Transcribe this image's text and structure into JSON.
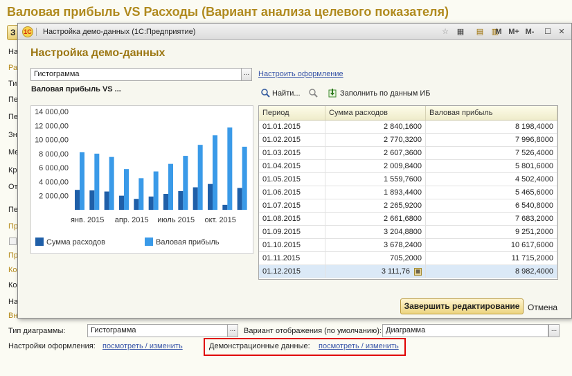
{
  "background": {
    "title": "Валовая прибыль VS Расходы (Вариант анализа целевого показателя)",
    "button_letter": "З",
    "side_labels": [
      "На",
      "Ра",
      "Тип",
      "Пе",
      "Пе",
      "Зна",
      "Ме",
      "Кр",
      "От",
      "Пе",
      "Пр",
      "",
      "Пр",
      "Ко",
      "Ко",
      "На",
      "Вн"
    ],
    "chart_type_label": "Тип диаграммы:",
    "chart_type_value": "Гистограмма",
    "display_variant_label": "Вариант отображения (по умолчанию):",
    "display_variant_value": "Диаграмма",
    "design_settings_label": "Настройки оформления:",
    "design_settings_link": "посмотреть / изменить",
    "demo_data_label": "Демонстрационные данные:",
    "demo_data_link": "посмотреть / изменить"
  },
  "modal": {
    "window_title": "Настройка демо-данных  (1С:Предприятие)",
    "app_icon_text": "1С",
    "heading": "Настройка демо-данных",
    "chart_type_value": "Гистограмма",
    "design_link": "Настроить оформление",
    "chart_title": "Валовая прибыль VS ...",
    "toolbar": {
      "find_label": "Найти...",
      "fill_label": "Заполнить по данным ИБ"
    },
    "titlebar_buttons": [
      "M",
      "M+",
      "M-"
    ],
    "columns": [
      "Период",
      "Сумма расходов",
      "Валовая прибыль"
    ],
    "rows": [
      [
        "01.01.2015",
        "2 840,1600",
        "8 198,4000"
      ],
      [
        "01.02.2015",
        "2 770,3200",
        "7 996,8000"
      ],
      [
        "01.03.2015",
        "2 607,3600",
        "7 526,4000"
      ],
      [
        "01.04.2015",
        "2 009,8400",
        "5 801,6000"
      ],
      [
        "01.05.2015",
        "1 559,7600",
        "4 502,4000"
      ],
      [
        "01.06.2015",
        "1 893,4400",
        "5 465,6000"
      ],
      [
        "01.07.2015",
        "2 265,9200",
        "6 540,8000"
      ],
      [
        "01.08.2015",
        "2 661,6800",
        "7 683,2000"
      ],
      [
        "01.09.2015",
        "3 204,8800",
        "9 251,2000"
      ],
      [
        "01.10.2015",
        "3 678,2400",
        "10 617,6000"
      ],
      [
        "01.11.2015",
        "705,2000",
        "11 715,2000"
      ],
      [
        "01.12.2015",
        "3 111,76",
        "8 982,4000"
      ]
    ],
    "finish_button": "Завершить редактирование",
    "cancel_button": "Отмена"
  },
  "chart_data": {
    "type": "bar",
    "categories": [
      "01.01.2015",
      "01.02.2015",
      "01.03.2015",
      "01.04.2015",
      "01.05.2015",
      "01.06.2015",
      "01.07.2015",
      "01.08.2015",
      "01.09.2015",
      "01.10.2015",
      "01.11.2015",
      "01.12.2015"
    ],
    "series": [
      {
        "name": "Сумма расходов",
        "color": "#1f5fa8",
        "values": [
          2840.16,
          2770.32,
          2607.36,
          2009.84,
          1559.76,
          1893.44,
          2265.92,
          2661.68,
          3204.88,
          3678.24,
          705.2,
          3111.76
        ]
      },
      {
        "name": "Валовая прибыль",
        "color": "#3a9ae8",
        "values": [
          8198.4,
          7996.8,
          7526.4,
          5801.6,
          4502.4,
          5465.6,
          6540.8,
          7683.2,
          9251.2,
          10617.6,
          11715.2,
          8982.4
        ]
      }
    ],
    "y_ticks": [
      "2 000,00",
      "4 000,00",
      "6 000,00",
      "8 000,00",
      "10 000,00",
      "12 000,00",
      "14 000,00"
    ],
    "x_tick_labels": [
      "янв. 2015",
      "апр. 2015",
      "июль 2015",
      "окт. 2015"
    ],
    "ylim": [
      0,
      14000
    ],
    "legend_placement": "bottom"
  }
}
